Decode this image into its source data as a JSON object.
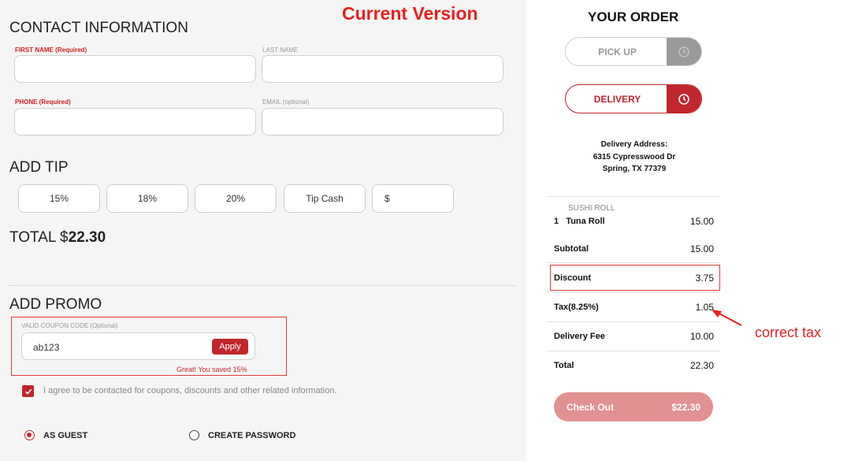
{
  "banner": "Current Version",
  "contact": {
    "title": "CONTACT INFORMATION",
    "first_name_label": "FIRST NAME (Required)",
    "last_name_label": "LAST NAME",
    "phone_label": "PHONE (Required)",
    "email_label": "EMAIL (optional)"
  },
  "tip": {
    "title": "ADD TIP",
    "options": [
      "15%",
      "18%",
      "20%",
      "Tip Cash"
    ],
    "custom_prefix": "$"
  },
  "total": {
    "prefix": "TOTAL $",
    "amount": "22.30"
  },
  "promo": {
    "title": "ADD PROMO",
    "label": "VALID COUPON CODE (Optional)",
    "value": "ab123",
    "apply_label": "Apply",
    "message": "Great! You saved 15%"
  },
  "agree": {
    "checked": true,
    "text": "I agree to be contacted for coupons, discounts and other related information."
  },
  "account": {
    "guest_label": "AS GUEST",
    "create_label": "CREATE PASSWORD",
    "selected": "guest"
  },
  "order": {
    "title": "YOUR ORDER",
    "pickup_label": "PICK UP",
    "delivery_label": "DELIVERY",
    "address_heading": "Delivery Address:",
    "address_line1": "6315 Cypresswood Dr",
    "address_line2": "Spring, TX 77379",
    "category": "SUSHI ROLL",
    "item": {
      "qty": "1",
      "name": "Tuna Roll",
      "price": "15.00"
    },
    "summary": [
      {
        "label": "Subtotal",
        "value": "15.00"
      },
      {
        "label": "Discount",
        "value": "3.75"
      },
      {
        "label": "Tax(8.25%)",
        "value": "1.05"
      },
      {
        "label": "Delivery Fee",
        "value": "10.00"
      },
      {
        "label": "Total",
        "value": "22.30"
      }
    ],
    "checkout_label": "Check Out",
    "checkout_amount": "$22.30"
  },
  "annotation": {
    "text": "correct tax"
  },
  "colors": {
    "accent": "#c0262b",
    "annotation": "#e8201f",
    "checkout": "#e19191"
  }
}
